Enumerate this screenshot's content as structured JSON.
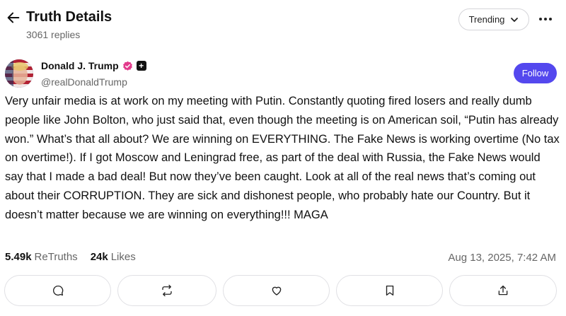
{
  "header": {
    "title": "Truth Details",
    "replies": "3061 replies",
    "sort_label": "Trending"
  },
  "author": {
    "name": "Donald J. Trump",
    "handle": "@realDonaldTrump",
    "follow_label": "Follow"
  },
  "post": {
    "text": "Very unfair media is at work on my meeting with Putin. Constantly quoting fired losers and really dumb people like John Bolton, who just said that, even though the meeting is on American soil, “Putin has already won.” What’s that all about? We are winning on EVERYTHING. The Fake News is working overtime (No tax on overtime!). If I got Moscow and Leningrad free, as part of the deal with Russia, the Fake News would say that I made a bad deal! But now they’ve been caught. Look at all of the real news that’s coming out about their CORRUPTION. They are sick and dishonest people, who probably hate our Country. But it doesn’t matter because we are winning on everything!!! MAGA",
    "retruths_count": "5.49k",
    "retruths_label": "ReTruths",
    "likes_count": "24k",
    "likes_label": "Likes",
    "timestamp": "Aug 13, 2025, 7:42 AM"
  },
  "colors": {
    "accent": "#5448ee",
    "verified": "#e23b8c"
  },
  "icons": [
    "back-arrow-icon",
    "chevron-down-icon",
    "more-icon",
    "verified-icon",
    "plus-icon",
    "reply-icon",
    "retruth-icon",
    "like-icon",
    "bookmark-icon",
    "share-icon"
  ]
}
